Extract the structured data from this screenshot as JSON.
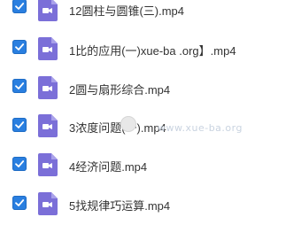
{
  "files": [
    {
      "name": "12圆柱与圆锥(三).mp4",
      "checked": true
    },
    {
      "name": "1比的应用(一)xue-ba .org】.mp4",
      "checked": true
    },
    {
      "name": "2圆与扇形综合.mp4",
      "checked": true
    },
    {
      "name": "3浓度问题(一).mp4",
      "checked": true
    },
    {
      "name": "4经济问题.mp4",
      "checked": true
    },
    {
      "name": "5找规律巧运算.mp4",
      "checked": true
    }
  ],
  "watermark": "www.xue-ba.org",
  "colors": {
    "checkbox": "#2a7fe0",
    "video_icon": "#7b6fd8"
  }
}
